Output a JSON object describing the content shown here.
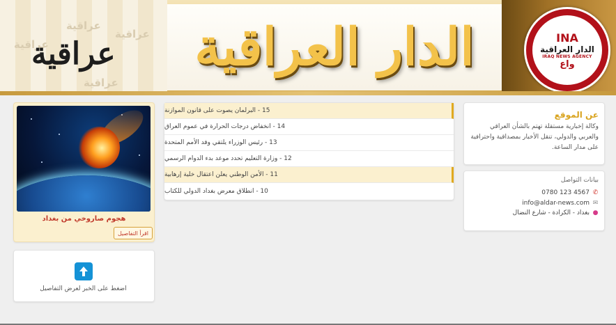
{
  "header": {
    "brand_small": "عراقية",
    "title": "الدار العراقية",
    "logo": {
      "abbr": "INA",
      "name_ar": "الدار العراقية",
      "name_en": "IRAQ NEWS AGENCY",
      "short_ar": "واع"
    }
  },
  "about": {
    "heading": "عن الموقع",
    "text": "وكالة إخبارية مستقلة تهتم بالشأن العراقي والعربي والدولي، تنقل الأخبار بمصداقية واحترافية على مدار الساعة."
  },
  "contact": {
    "heading": "بيانات التواصل",
    "phone": "0780 123 4567",
    "email": "info@aldar-news.com",
    "address": "بغداد - الكرادة - شارع النضال",
    "icons": {
      "phone": "phone-icon",
      "email": "envelope-icon",
      "address": "map-pin-icon"
    }
  },
  "news": {
    "items": [
      {
        "label": "15 - البرلمان يصوت على قانون الموازنة",
        "highlight": true
      },
      {
        "label": "14 - انخفاض درجات الحرارة في عموم العراق",
        "highlight": false
      },
      {
        "label": "13 - رئيس الوزراء يلتقي وفد الأمم المتحدة",
        "highlight": false
      },
      {
        "label": "12 - وزارة التعليم تحدد موعد بدء الدوام الرسمي",
        "highlight": false
      },
      {
        "label": "11 - الأمن الوطني يعلن اعتقال خلية إرهابية",
        "highlight": true
      },
      {
        "label": "10 - انطلاق معرض بغداد الدولي للكتاب",
        "highlight": false
      }
    ]
  },
  "feature": {
    "title": "هجوم صاروخي من بغداد",
    "button": "اقرأ التفاصيل"
  },
  "cta": {
    "text": "اضغط على الخبر لعرض التفاصيل",
    "icon": "arrow-up-icon"
  },
  "colors": {
    "accent": "#d9a420",
    "highlight_bg": "#fbf0cf",
    "link_red": "#c0392b",
    "button_blue": "#1592d6"
  }
}
